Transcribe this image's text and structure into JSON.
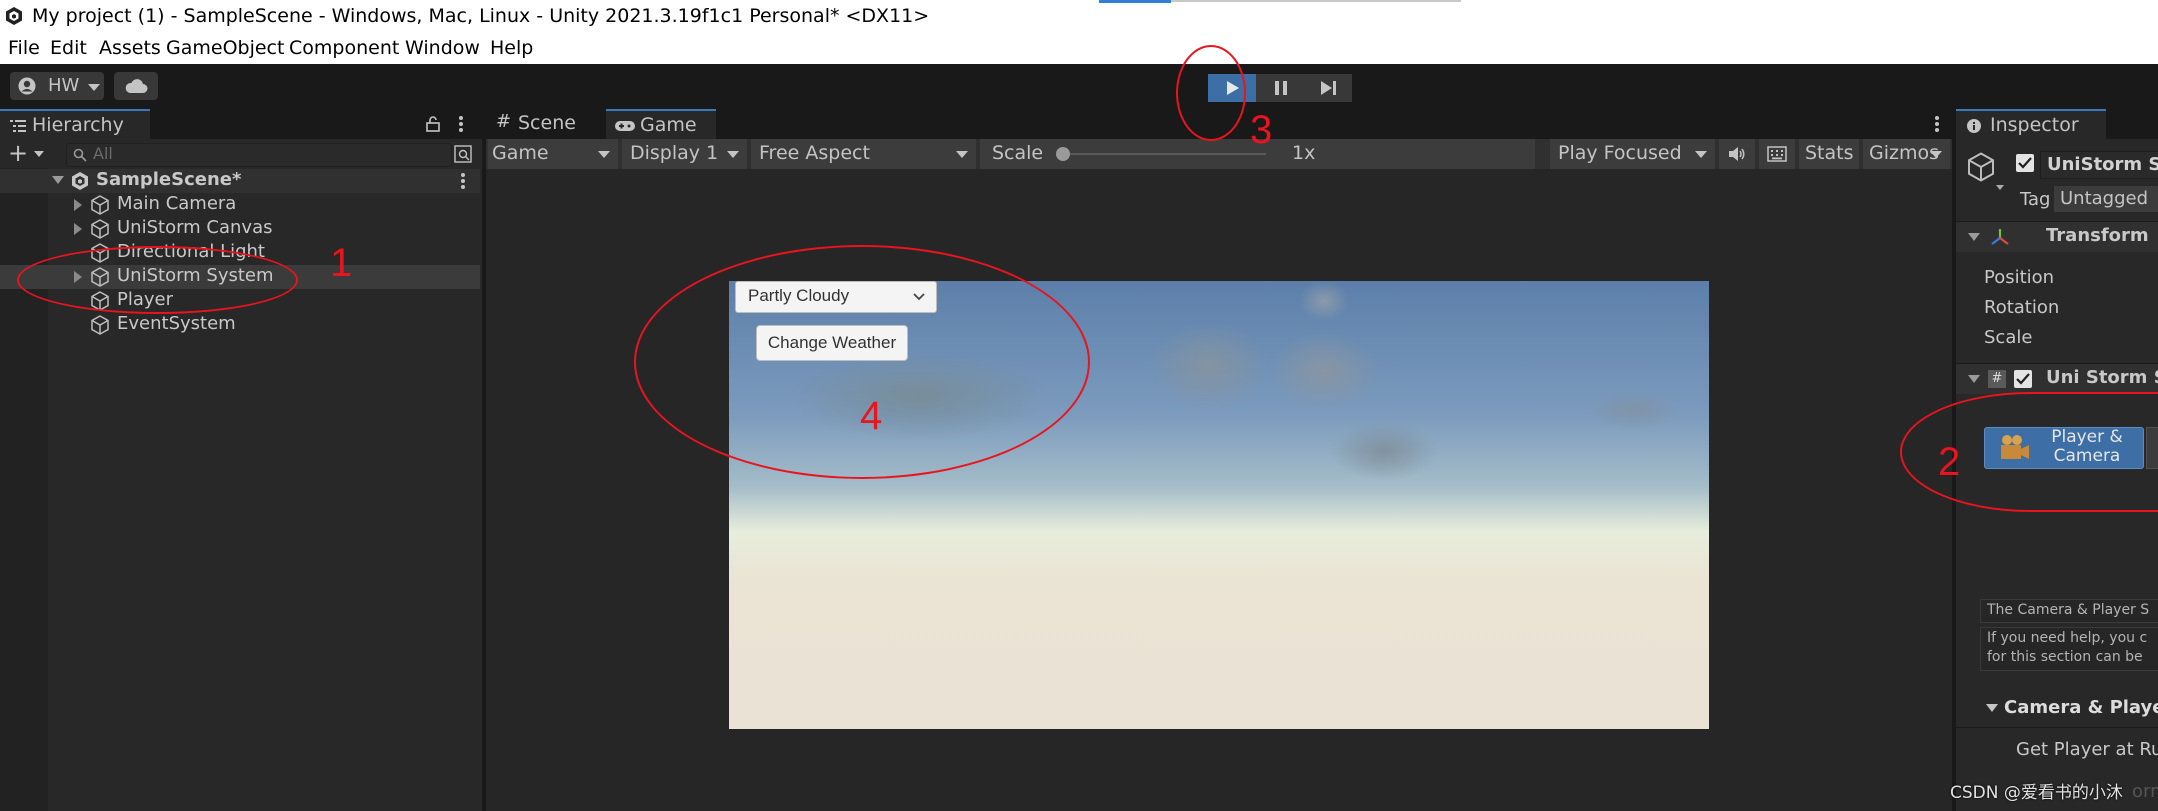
{
  "window": {
    "title": "My project (1) - SampleScene - Windows, Mac, Linux - Unity 2021.3.19f1c1 Personal* <DX11>"
  },
  "menu": [
    "File",
    "Edit",
    "Assets",
    "GameObject",
    "Component",
    "Window",
    "Help"
  ],
  "toolbar": {
    "account_label": "HW",
    "icons": [
      "account-icon",
      "cloud-icon",
      "play-icon",
      "pause-icon",
      "step-icon"
    ]
  },
  "hierarchy": {
    "title": "Hierarchy",
    "search_placeholder": "All",
    "scene_name": "SampleScene*",
    "items": [
      "Main Camera",
      "UniStorm Canvas",
      "Directional Light",
      "UniStorm System",
      "Player",
      "EventSystem"
    ]
  },
  "game_view": {
    "tabs": [
      "Scene",
      "Game"
    ],
    "controls": {
      "view_select": "Game",
      "display_select": "Display 1",
      "aspect_select": "Free Aspect",
      "scale_label": "Scale",
      "scale_value": "1x",
      "play_mode": "Play Focused",
      "stats": "Stats",
      "gizmos": "Gizmos"
    },
    "scale_level": 0,
    "dropdown_value": "Partly Cloudy",
    "button_label": "Change Weather"
  },
  "inspector": {
    "title": "Inspector",
    "object_name": "UniStorm S",
    "tag_label": "Tag",
    "tag_value": "Untagged",
    "transform_title": "Transform",
    "transform_fields": [
      "Position",
      "Rotation",
      "Scale"
    ],
    "component_title": "Uni Storm Sy",
    "player_camera_button": "Player & Camera",
    "help_box_title": "The Camera & Player S",
    "help_box_text_1": "If you need help, you c",
    "help_box_text_2": "for this section can be",
    "section_title": "Camera & Player",
    "section_field": "Get Player at Ru",
    "clipped_text": "orm"
  },
  "annotations": [
    "1",
    "2",
    "3",
    "4"
  ],
  "watermark": "CSDN @爱看书的小沐",
  "colors": {
    "accent": "#3a79bb",
    "annotation_red": "#e8141e",
    "panel_bg": "#282828",
    "sky_top": "#5f82ab",
    "ground": "#eae3d6"
  }
}
